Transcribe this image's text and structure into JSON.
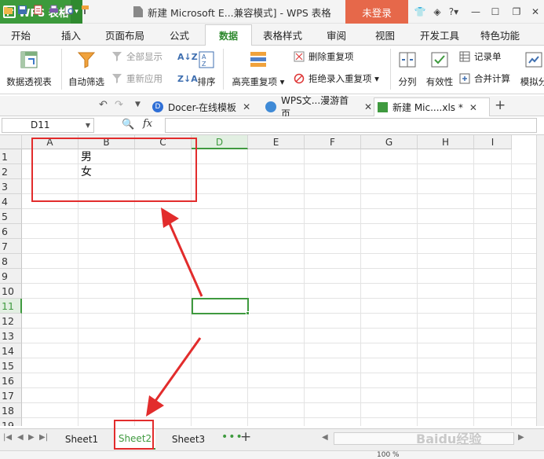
{
  "app": {
    "name": "WPS 表格"
  },
  "window": {
    "title": "新建 Microsoft E...兼容模式] - WPS 表格",
    "login_label": "未登录"
  },
  "menu": {
    "tabs": [
      "开始",
      "插入",
      "页面布局",
      "公式",
      "数据",
      "表格样式",
      "审阅",
      "视图",
      "开发工具",
      "特色功能"
    ],
    "active": "数据"
  },
  "ribbon": {
    "pivot": "数据透视表",
    "autofilter": "自动筛选",
    "show_all": "全部显示",
    "reapply": "重新应用",
    "sort": "排序",
    "highlight_dup": "高亮重复项",
    "remove_dup": "删除重复项",
    "reject_dup": "拒绝录入重复项",
    "split": "分列",
    "validity": "有效性",
    "record": "记录单",
    "merge_calc": "合并计算",
    "simulate": "模拟分"
  },
  "doc_tabs": [
    {
      "label": "Docer-在线模板"
    },
    {
      "label": "WPS文...漫游首页"
    },
    {
      "label": "新建 Mic....xls *"
    }
  ],
  "formula_bar": {
    "name_box": "D11",
    "fx": "fx",
    "value": ""
  },
  "grid": {
    "columns": [
      "A",
      "B",
      "C",
      "D",
      "E",
      "F",
      "G",
      "H",
      "I"
    ],
    "rows": [
      "1",
      "2",
      "3",
      "4",
      "5",
      "6",
      "7",
      "8",
      "9",
      "10",
      "11",
      "12",
      "13",
      "14",
      "15",
      "16",
      "17",
      "18",
      "19"
    ],
    "selected_cell": "D11",
    "cells": [
      {
        "ref": "B1",
        "value": "男"
      },
      {
        "ref": "B2",
        "value": "女"
      }
    ]
  },
  "sheets": {
    "tabs": [
      "Sheet1",
      "Sheet2",
      "Sheet3"
    ],
    "active": "Sheet2"
  },
  "status": {
    "zoom": "100 %"
  },
  "watermark": "Baidu经验",
  "colors": {
    "accent": "#3f9a3f",
    "login": "#e6684a",
    "annotation": "#e22c2c"
  }
}
